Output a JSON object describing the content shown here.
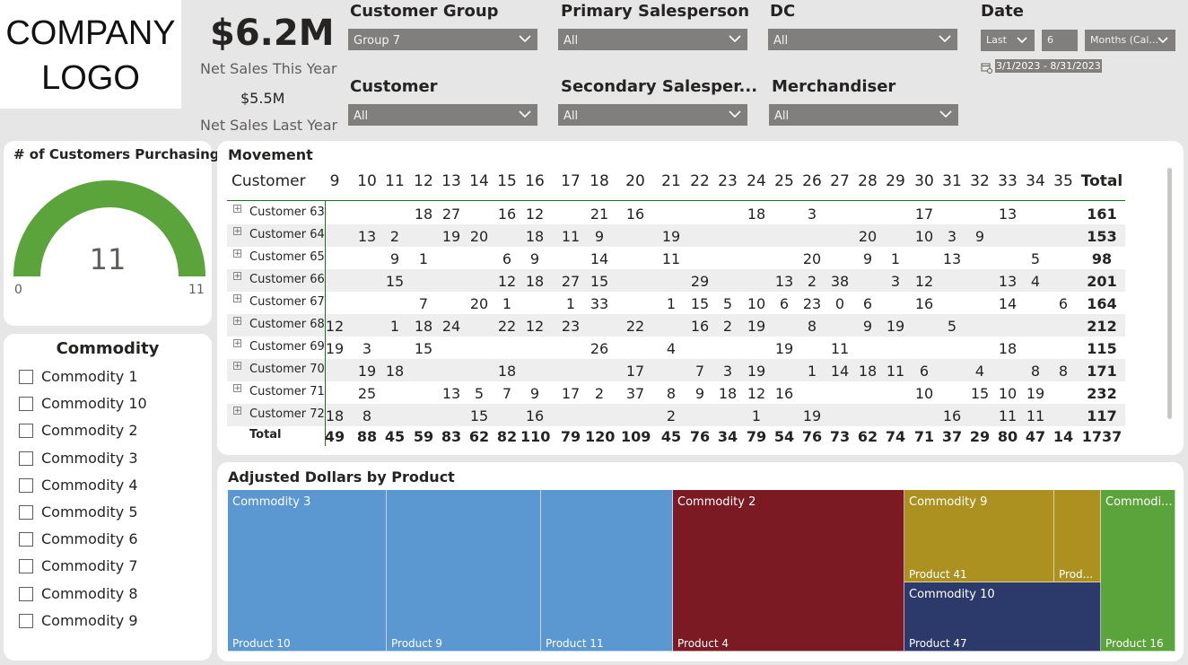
{
  "logo": {
    "line1": "COMPANY",
    "line2": "LOGO"
  },
  "kpi": {
    "this_year_value": "$6.2M",
    "this_year_label": "Net Sales This Year",
    "last_year_value": "$5.5M",
    "last_year_label": "Net Sales Last Year"
  },
  "filters": {
    "customer_group": {
      "label": "Customer Group",
      "value": "Group 7"
    },
    "primary_salesperson": {
      "label": "Primary Salesperson",
      "value": "All"
    },
    "dc": {
      "label": "DC",
      "value": "All"
    },
    "customer": {
      "label": "Customer",
      "value": "All"
    },
    "secondary_salesperson": {
      "label": "Secondary Salesper...",
      "value": "All"
    },
    "merchandiser": {
      "label": "Merchandiser",
      "value": "All"
    },
    "date": {
      "label": "Date",
      "mode": "Last",
      "count": "6",
      "unit": "Months (Cal...",
      "range": "3/1/2023 - 8/31/2023"
    }
  },
  "gauge": {
    "title": "# of Customers Purchasing",
    "value": "11",
    "min": "0",
    "max": "11",
    "fill_fraction": 1.0,
    "color": "#5ba33b"
  },
  "commodity_slicer": {
    "title": "Commodity",
    "items": [
      "Commodity 1",
      "Commodity 10",
      "Commodity 2",
      "Commodity 3",
      "Commodity 4",
      "Commodity 5",
      "Commodity 6",
      "Commodity 7",
      "Commodity 8",
      "Commodity 9"
    ]
  },
  "movement": {
    "title": "Movement",
    "row_header": "Customer",
    "columns": [
      "9",
      "10",
      "11",
      "12",
      "13",
      "14",
      "15",
      "16",
      "17",
      "18",
      "20",
      "21",
      "22",
      "23",
      "24",
      "25",
      "26",
      "27",
      "28",
      "29",
      "30",
      "31",
      "32",
      "33",
      "34",
      "35"
    ],
    "total_label": "Total",
    "rows": [
      {
        "name": "Customer 63",
        "cells": [
          "",
          "",
          "",
          "18",
          "27",
          "",
          "16",
          "12",
          "",
          "21",
          "16",
          "",
          "",
          "",
          "18",
          "",
          "3",
          "",
          "",
          "",
          "17",
          "",
          "",
          "13",
          "",
          ""
        ],
        "total": "161"
      },
      {
        "name": "Customer 64",
        "cells": [
          "",
          "13",
          "2",
          "",
          "19",
          "20",
          "",
          "18",
          "11",
          "9",
          "",
          "19",
          "",
          "",
          "",
          "",
          "",
          "",
          "20",
          "",
          "10",
          "3",
          "9",
          "",
          "",
          ""
        ],
        "total": "153"
      },
      {
        "name": "Customer 65",
        "cells": [
          "",
          "",
          "9",
          "1",
          "",
          "",
          "6",
          "9",
          "",
          "14",
          "",
          "11",
          "",
          "",
          "",
          "",
          "20",
          "",
          "9",
          "1",
          "",
          "13",
          "",
          "",
          "5",
          ""
        ],
        "total": "98"
      },
      {
        "name": "Customer 66",
        "cells": [
          "",
          "",
          "15",
          "",
          "",
          "",
          "12",
          "18",
          "27",
          "15",
          "",
          "",
          "29",
          "",
          "",
          "13",
          "2",
          "38",
          "",
          "3",
          "12",
          "",
          "",
          "13",
          "4",
          ""
        ],
        "total": "201"
      },
      {
        "name": "Customer 67",
        "cells": [
          "",
          "",
          "",
          "7",
          "",
          "20",
          "1",
          "",
          "1",
          "33",
          "",
          "1",
          "15",
          "5",
          "10",
          "6",
          "23",
          "0",
          "6",
          "",
          "16",
          "",
          "",
          "14",
          "",
          "6"
        ],
        "total": "164"
      },
      {
        "name": "Customer 68",
        "cells": [
          "12",
          "",
          "1",
          "18",
          "24",
          "",
          "22",
          "12",
          "23",
          "",
          "22",
          "",
          "16",
          "2",
          "19",
          "",
          "8",
          "",
          "9",
          "19",
          "",
          "5",
          "",
          "",
          "",
          ""
        ],
        "total": "212"
      },
      {
        "name": "Customer 69",
        "cells": [
          "19",
          "3",
          "",
          "15",
          "",
          "",
          "",
          "",
          "",
          "26",
          "",
          "4",
          "",
          "",
          "",
          "19",
          "",
          "11",
          "",
          "",
          "",
          "",
          "",
          "18",
          "",
          ""
        ],
        "total": "115"
      },
      {
        "name": "Customer 70",
        "cells": [
          "",
          "19",
          "18",
          "",
          "",
          "",
          "18",
          "",
          "",
          "",
          "17",
          "",
          "7",
          "3",
          "19",
          "",
          "1",
          "14",
          "18",
          "11",
          "6",
          "",
          "4",
          "",
          "8",
          "8"
        ],
        "total": "171"
      },
      {
        "name": "Customer 71",
        "cells": [
          "",
          "25",
          "",
          "",
          "13",
          "5",
          "7",
          "9",
          "17",
          "2",
          "37",
          "8",
          "9",
          "18",
          "12",
          "16",
          "",
          "",
          "",
          "",
          "10",
          "",
          "15",
          "10",
          "19",
          ""
        ],
        "total": "232"
      },
      {
        "name": "Customer 72",
        "cells": [
          "18",
          "8",
          "",
          "",
          "",
          "15",
          "",
          "16",
          "",
          "",
          "",
          "2",
          "",
          "",
          "1",
          "",
          "19",
          "",
          "",
          "",
          "",
          "16",
          "",
          "11",
          "11",
          ""
        ],
        "total": "117"
      }
    ],
    "totals": [
      "49",
      "88",
      "45",
      "59",
      "83",
      "62",
      "82",
      "110",
      "79",
      "120",
      "109",
      "45",
      "76",
      "34",
      "79",
      "54",
      "76",
      "73",
      "62",
      "74",
      "71",
      "37",
      "29",
      "80",
      "47",
      "14"
    ],
    "grand_total": "1737"
  },
  "treemap": {
    "title": "Adjusted Dollars by Product",
    "groups": [
      {
        "commodity": "Commodity 3",
        "color": "#5b97d1",
        "products": [
          "Product 10",
          "Product 9",
          "Product 11"
        ]
      },
      {
        "commodity": "Commodity 2",
        "color": "#7b1a23",
        "products": [
          "Product 4"
        ]
      },
      {
        "commodity": "Commodity 9",
        "color": "#ac9121",
        "products": [
          "Product 41",
          "Prod..."
        ]
      },
      {
        "commodity": "Commodity 10",
        "color": "#2c3a6b",
        "products": [
          "Product 47"
        ]
      },
      {
        "commodity": "Commodi...",
        "color": "#5ba33b",
        "products": [
          "Product 16"
        ]
      }
    ]
  }
}
